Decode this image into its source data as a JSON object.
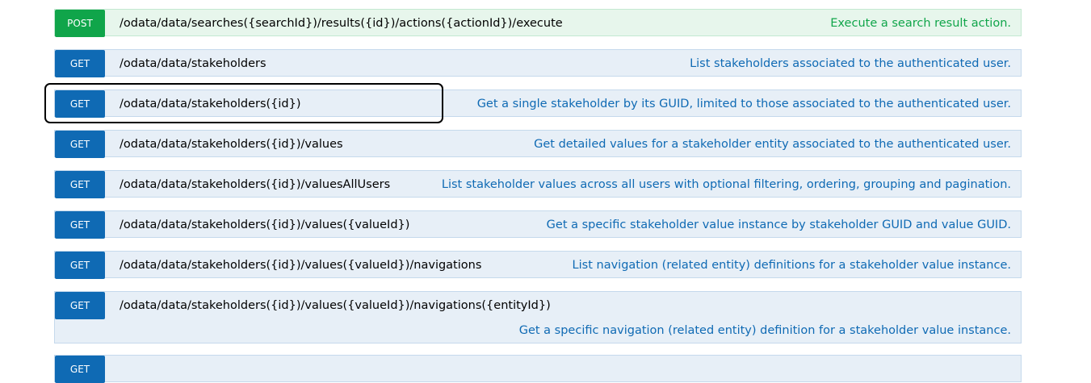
{
  "operations": [
    {
      "method": "POST",
      "path": "/odata/data/searches({searchId})/results({id})/actions({actionId})/execute",
      "summary": "Execute a search result action."
    },
    {
      "method": "GET",
      "path": "/odata/data/stakeholders",
      "summary": "List stakeholders associated to the authenticated user."
    },
    {
      "method": "GET",
      "path": "/odata/data/stakeholders({id})",
      "summary": "Get a single stakeholder by its GUID, limited to those associated to the authenticated user."
    },
    {
      "method": "GET",
      "path": "/odata/data/stakeholders({id})/values",
      "summary": "Get detailed values for a stakeholder entity associated to the authenticated user."
    },
    {
      "method": "GET",
      "path": "/odata/data/stakeholders({id})/valuesAllUsers",
      "summary": "List stakeholder values across all users with optional filtering, ordering, grouping and pagination."
    },
    {
      "method": "GET",
      "path": "/odata/data/stakeholders({id})/values({valueId})",
      "summary": "Get a specific stakeholder value instance by stakeholder GUID and value GUID."
    },
    {
      "method": "GET",
      "path": "/odata/data/stakeholders({id})/values({valueId})/navigations",
      "summary": "List navigation (related entity) definitions for a stakeholder value instance."
    },
    {
      "method": "GET",
      "path": "/odata/data/stakeholders({id})/values({valueId})/navigations({entityId})",
      "summary": "Get a specific navigation (related entity) definition for a stakeholder value instance."
    },
    {
      "method": "GET",
      "path": "",
      "summary": ""
    }
  ],
  "colors": {
    "get_accent": "#0f6ab4",
    "post_accent": "#10a54a",
    "get_background": "#e7eff7",
    "post_background": "#e7f6ec"
  }
}
